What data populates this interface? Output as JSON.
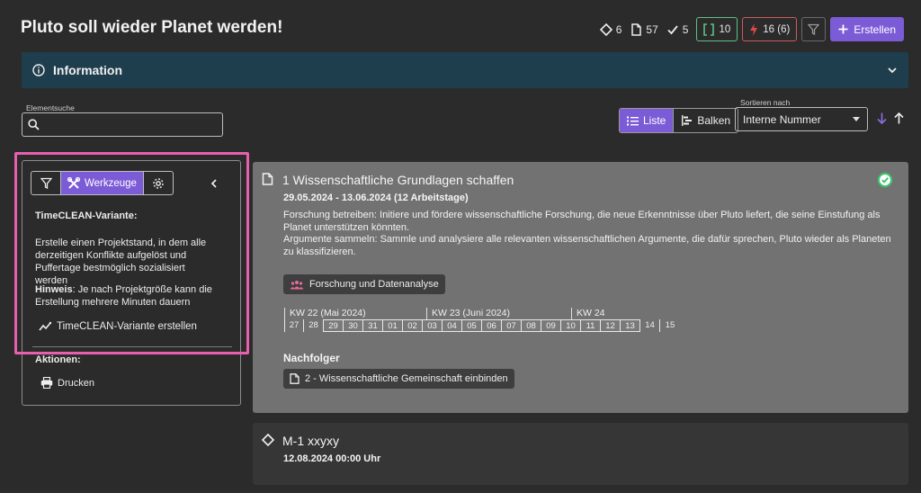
{
  "header": {
    "title": "Pluto soll wieder Planet werden!",
    "stats": [
      {
        "icon": "diamond-icon",
        "value": "6"
      },
      {
        "icon": "document-icon",
        "value": "57"
      },
      {
        "icon": "check-icon",
        "value": "5"
      }
    ],
    "chip_green": {
      "icon": "bracket-icon",
      "value": "10",
      "color": "#5fbf87"
    },
    "chip_red": {
      "icon": "lightning-icon",
      "value": "16 (6)",
      "color": "#e04848"
    },
    "create_label": "Erstellen",
    "accent": "#7c5cd6"
  },
  "info": {
    "title": "Information",
    "bar_color": "#1f3e4d"
  },
  "search": {
    "label": "Elementsuche",
    "value": ""
  },
  "view": {
    "list_label": "Liste",
    "bar_label": "Balken",
    "active": "Liste"
  },
  "sort": {
    "label": "Sortieren nach",
    "selected": "Interne Nummer"
  },
  "left_panel": {
    "tools_label": "Werkzeuge",
    "variant_title": "TimeCLEAN-Variante:",
    "variant_desc": "Erstelle einen Projektstand, in dem alle derzeitigen Konflikte aufgelöst und Puffertage bestmöglich sozialisiert werden",
    "hint_label": "Hinweis",
    "hint_text": ": Je nach Projektgröße kann die Erstellung mehrere Minuten dauern",
    "create_variant": "TimeCLEAN-Variante erstellen",
    "actions_label": "Aktionen:",
    "print_label": "Drucken",
    "highlight_color": "#e75fae"
  },
  "card1": {
    "title": "1 Wissenschaftliche Grundlagen schaffen",
    "date": "29.05.2024 - 13.06.2024 (12 Arbeitstage)",
    "desc1": "Forschung betreiben: Initiere und fördere wissenschaftliche Forschung, die neue Erkenntnisse über Pluto liefert, die seine Einstufung als Planet unterstützen könnten.",
    "desc2": "Argumente sammeln: Sammle und analysiere alle relevanten wissenschaftlichen Argumente, die dafür sprechen, Pluto wieder als Planeten zu klassifizieren.",
    "tag": "Forschung und Datenanalyse",
    "weeks": [
      "KW 22 (Mai 2024)",
      "KW 23 (Juni 2024)",
      "KW 24"
    ],
    "days": [
      "27",
      "28",
      "29",
      "30",
      "31",
      "01",
      "02",
      "03",
      "04",
      "05",
      "06",
      "07",
      "08",
      "09",
      "10",
      "11",
      "12",
      "13",
      "14",
      "15"
    ],
    "successor_label": "Nachfolger",
    "successor": "2 - Wissenschaftliche Gemeinschaft einbinden",
    "status_color": "#3cc46a"
  },
  "card2": {
    "title": "M-1 xxyxy",
    "date": "12.08.2024 00:00 Uhr"
  }
}
